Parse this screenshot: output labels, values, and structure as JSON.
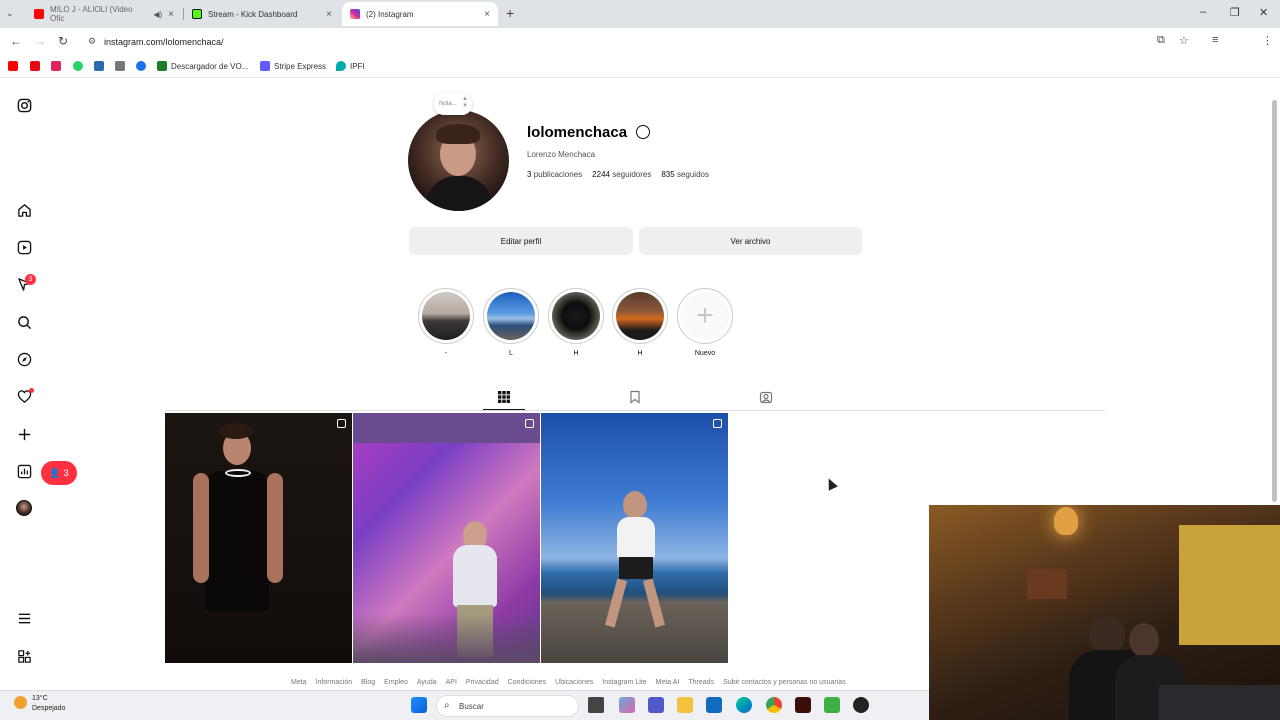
{
  "browser": {
    "tabs": [
      {
        "title": "MILO J - ALIOLI (Video Ofic",
        "favicon_color": "#ff0000",
        "muted_icon": "speaker-icon"
      },
      {
        "title": "Stream - Kick Dashboard",
        "favicon_color": "#53fc18"
      },
      {
        "title": "(2) Instagram",
        "favicon_color": "#d6249f",
        "active": true
      }
    ],
    "url": "instagram.com/lolomenchaca/",
    "bookmarks": [
      {
        "label": "",
        "color": "#ff0000"
      },
      {
        "label": "",
        "color": "#e50914"
      },
      {
        "label": "",
        "color": "#e0245e"
      },
      {
        "label": "",
        "color": "#25d366"
      },
      {
        "label": "",
        "color": "#2b6cb0"
      },
      {
        "label": "",
        "color": "#555555"
      },
      {
        "label": "",
        "color": "#1a73e8"
      },
      {
        "label": "Descargador de VO...",
        "color": "#1d7f2a"
      },
      {
        "label": "Stripe Express",
        "color": "#635bff"
      },
      {
        "label": "IPFI",
        "color": "#0aa"
      }
    ]
  },
  "profile": {
    "username": "lolomenchaca",
    "full_name": "Lorenzo Menchaca",
    "note_placeholder": "Nota...",
    "stats": {
      "posts": "3",
      "posts_label": "publicaciones",
      "followers": "2244",
      "followers_label": "seguidores",
      "following": "835",
      "following_label": "seguidos"
    },
    "edit_button": "Editar perfil",
    "archive_button": "Ver archivo"
  },
  "highlights": [
    {
      "label": "-"
    },
    {
      "label": "L"
    },
    {
      "label": "H"
    },
    {
      "label": "H"
    },
    {
      "label": "Nuevo"
    }
  ],
  "sidebar": {
    "notifications_badge": "3",
    "activity_count": "3"
  },
  "footer_links": [
    "Meta",
    "Información",
    "Blog",
    "Empleo",
    "Ayuda",
    "API",
    "Privacidad",
    "Condiciones",
    "Ubicaciones",
    "Instagram Lite",
    "Meta AI",
    "Threads",
    "Subir contactos y personas no usuarias"
  ],
  "taskbar": {
    "temperature": "13°C",
    "weather": "Despejado",
    "search_placeholder": "Buscar"
  }
}
